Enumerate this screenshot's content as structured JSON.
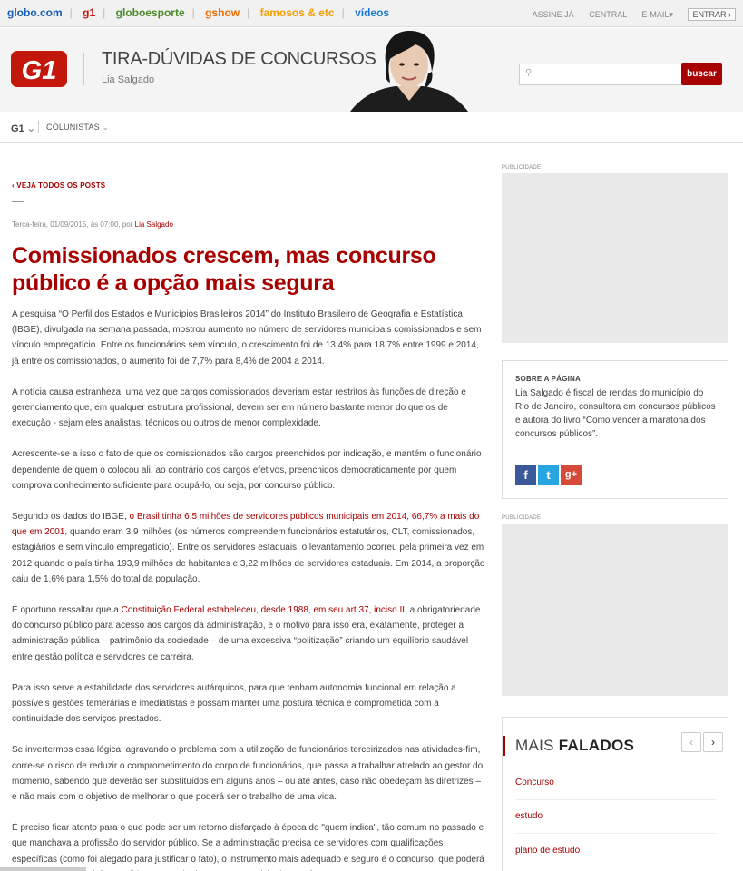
{
  "globobar": {
    "links": [
      {
        "label": "globo.com",
        "color": "#1a5fb4"
      },
      {
        "label": "g1",
        "color": "#c4170c"
      },
      {
        "label": "globoesporte",
        "color": "#4a8c2a"
      },
      {
        "label": "gshow",
        "color": "#f26c00"
      },
      {
        "label": "famosos & etc",
        "color": "#f2a000"
      },
      {
        "label": "vídeos",
        "color": "#1a7ad4"
      }
    ],
    "right_links": [
      "ASSINE JÁ",
      "CENTRAL",
      "E-MAIL"
    ],
    "email_arrow": "▾",
    "entrar": "ENTRAR",
    "entrar_arrow": "›"
  },
  "header": {
    "blog_title": "TIRA-DÚVIDAS DE CONCURSOS",
    "author": "Lia Salgado",
    "logo_text": "G1",
    "search_placeholder": "",
    "search_icon": "⚲",
    "search_button": "buscar"
  },
  "nav": {
    "g1": "G1",
    "g1_arrow": "⌄",
    "colunistas": "COLUNISTAS",
    "colunistas_arrow": "⌄"
  },
  "post": {
    "back_link": "‹ VEJA TODOS OS POSTS",
    "meta_date": "Terça-feira, 01/09/2015, às 07:00, por ",
    "meta_author": "Lia Salgado",
    "headline": "Comissionados crescem, mas concurso público é a opção mais segura",
    "paragraphs": [
      {
        "text": "A pesquisa “O Perfil dos Estados e Municípios Brasileiros 2014” do Instituto Brasileiro de Geografia e Estatística (IBGE), divulgada na semana passada, mostrou aumento no número de servidores municipais comissionados e sem vínculo empregatício. Entre os funcionários sem vínculo, o crescimento foi de 13,4% para 18,7% entre 1999 e 2014, já entre os comissionados, o aumento foi de 7,7% para 8,4% de 2004 a 2014."
      },
      {
        "text": "A notícia causa estranheza, uma vez que cargos comissionados deveriam estar restritos às funções de direção e gerenciamento que, em qualquer estrutura profissional, devem ser em número bastante menor do que os de execução - sejam eles analistas, técnicos ou outros de menor complexidade."
      },
      {
        "text": "Acrescente-se a isso o fato de que os comissionados são cargos preenchidos por indicação, e mantém o funcionário dependente de quem o colocou ali, ao contrário dos cargos efetivos, preenchidos democraticamente por quem comprova conhecimento suficiente para ocupá-lo, ou seja, por concurso público."
      },
      {
        "before": "Segundo os dados do IBGE, ",
        "link": "o Brasil tinha 6,5 milhões de servidores públicos municipais em 2014, 66,7% a mais do que em 2001",
        "after": ", quando eram 3,9 milhões (os números compreendem funcionários estatutários, CLT, comissionados, estagiários e sem vínculo empregatício). Entre os servidores estaduais, o levantamento ocorreu pela primeira vez em 2012 quando o país tinha 193,9 milhões de habitantes e 3,22 milhões de servidores estaduais. Em 2014, a proporção caiu de 1,6% para 1,5% do total da população."
      },
      {
        "before": "É oportuno ressaltar que a ",
        "link": "Constituição Federal estabeleceu, desde 1988, em seu art.37, inciso II",
        "after": ", a obrigatoriedade do concurso público para acesso aos cargos da administração, e o motivo para isso era, exatamente, proteger a administração pública – patrimônio da sociedade – de uma excessiva “politização” criando um equilíbrio saudável entre gestão política e servidores de carreira."
      },
      {
        "text": "Para isso serve a estabilidade dos servidores autárquicos, para que tenham autonomia funcional em relação a possíveis gestões temerárias e imediatistas e possam manter uma postura técnica e comprometida com a continuidade dos serviços prestados."
      },
      {
        "text": "Se invertermos essa lógica, agravando o problema com a utilização de funcionários terceirizados nas atividades-fim, corre-se o risco de reduzir o comprometimento do corpo de funcionários, que passa a trabalhar atrelado ao gestor do momento, sabendo que deverão ser substituídos em alguns anos – ou até antes, caso não obedeçam às diretrizes – e não mais com o objetivo de melhorar o que poderá ser o trabalho de uma vida."
      },
      {
        "text": "É preciso ficar atento para o que pode ser um retorno disfarçado à época do \"quem indica\", tão comum no passado e que manchava a profissão do servidor público. Se a administração precisa de servidores com qualificações específicas (como foi alegado para justificar o fato), o instrumento mais adequado e seguro é o concurso, que poderá selecionar com precisão candidatos capacitados para o exercício das tarefas."
      }
    ]
  },
  "sidebar": {
    "publicidade": "PUBLICIDADE",
    "about_title": "SOBRE A PÁGINA",
    "about_text": "Lia Salgado é fiscal de rendas do município do Rio de Janeiro, consultora em concursos públicos e autora do livro “Como vencer a maratona dos concursos públicos”.",
    "social": {
      "fb": "f",
      "tw": "t",
      "gp": "g+"
    },
    "mais_light": "MAIS ",
    "mais_bold": "FALADOS",
    "prev": "‹",
    "next": "›",
    "mais_items": [
      "Concurso",
      "estudo",
      "plano de estudo"
    ]
  }
}
